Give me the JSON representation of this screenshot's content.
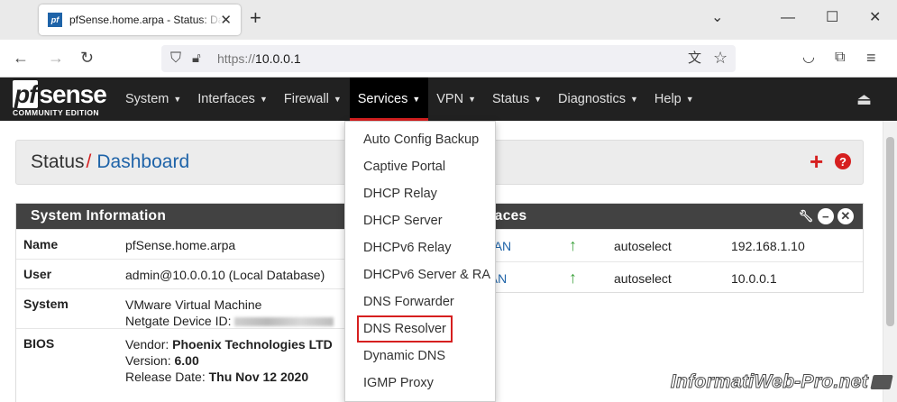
{
  "browser": {
    "tab_title": "pfSense.home.arpa - Status: Da",
    "tab_favicon": "pf",
    "url_scheme": "https://",
    "url_host": "10.0.0.1",
    "icons": [
      "back-icon",
      "forward-icon",
      "reload-icon",
      "shield-icon",
      "lock-icon",
      "translate-icon",
      "star-icon",
      "pocket-icon",
      "extensions-icon",
      "menu-icon",
      "chevron-down-icon",
      "minimize-icon",
      "maximize-icon",
      "close-icon"
    ]
  },
  "pfnav": {
    "logo_main_pf": "pf",
    "logo_main_rest": "sense",
    "logo_sub": "COMMUNITY EDITION",
    "menu": [
      "System",
      "Interfaces",
      "Firewall",
      "Services",
      "VPN",
      "Status",
      "Diagnostics",
      "Help"
    ],
    "active": "Services"
  },
  "breadcrumb": {
    "part1": "Status",
    "sep": "/",
    "part2": "Dashboard"
  },
  "sysinfo": {
    "title": "System Information",
    "rows": [
      {
        "k": "Name",
        "v1": "pfSense.home.arpa",
        "v2": ""
      },
      {
        "k": "User",
        "v1": "admin@10.0.0.10 (Local Database)",
        "v2": ""
      },
      {
        "k": "System",
        "v1": "VMware Virtual Machine",
        "v2": "Netgate Device ID:"
      },
      {
        "k": "BIOS",
        "v1_label": "Vendor: ",
        "v1_val": "Phoenix Technologies LTD",
        "v2_label": "Version: ",
        "v2_val": "6.00",
        "v3_label": "Release Date: ",
        "v3_val": "Thu Nov 12 2020"
      }
    ]
  },
  "interfaces": {
    "title": "rfaces",
    "rows": [
      {
        "name": "WAN",
        "status": "↑",
        "media": "autoselect",
        "ip": "192.168.1.10"
      },
      {
        "name": "LAN",
        "status": "↑",
        "media": "autoselect",
        "ip": "10.0.0.1"
      }
    ]
  },
  "services_menu": [
    "Auto Config Backup",
    "Captive Portal",
    "DHCP Relay",
    "DHCP Server",
    "DHCPv6 Relay",
    "DHCPv6 Server & RA",
    "DNS Forwarder",
    "DNS Resolver",
    "Dynamic DNS",
    "IGMP Proxy"
  ],
  "highlighted_item": "DNS Resolver",
  "colors": {
    "accent_red": "#d61f1f",
    "link_blue": "#1e63a8",
    "nav_bg": "#212121",
    "panel_head": "#424242",
    "status_green": "#3fa33f"
  },
  "watermark": "InformatiWeb-Pro.net"
}
